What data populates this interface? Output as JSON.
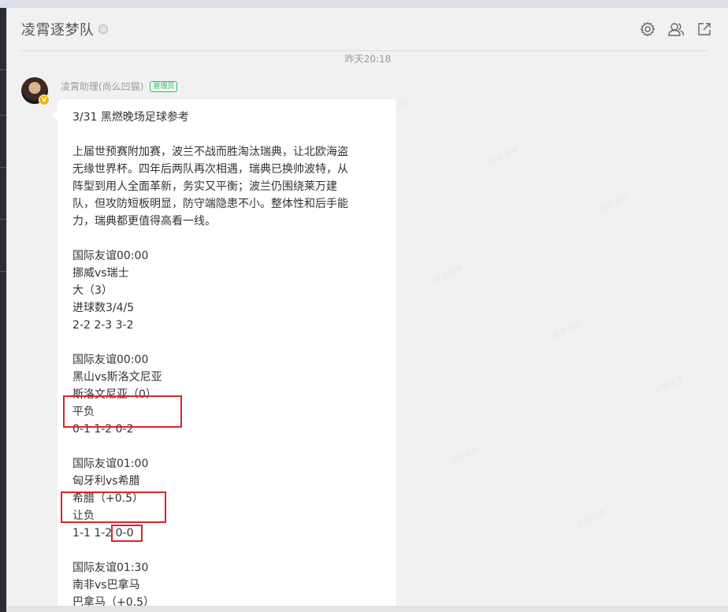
{
  "group": {
    "title": "凌霄逐梦队"
  },
  "header_icons": [
    "gear-icon",
    "members-icon",
    "popout-icon"
  ],
  "timestamp": "昨天20:18",
  "sender": {
    "name": "凌霄助理(尚么凹猫)",
    "badge": "管理员"
  },
  "message": {
    "title": "3/31 黑燃晚场足球参考",
    "intro": [
      "上届世预赛附加赛，波兰不战而胜淘汰瑞典，让北欧海盗",
      "无缘世界杯。四年后两队再次相遇，瑞典已换帅波特，从",
      "阵型到用人全面革新，务实又平衡；波兰仍围绕莱万建",
      "队，但攻防短板明显，防守端隐患不小。整体性和后手能",
      "力，瑞典都更值得高看一线。"
    ],
    "matches": [
      {
        "time": "国际友谊00:00",
        "teams": "挪威vs瑞士",
        "pick": "大（3）",
        "result": "进球数3/4/5",
        "scores": "2-2 2-3 3-2"
      },
      {
        "time": "国际友谊00:00",
        "teams": "黑山vs斯洛文尼亚",
        "pick": "斯洛文尼亚（0）",
        "result": "平负",
        "scores": "0-1 1-2 0-2"
      },
      {
        "time": "国际友谊01:00",
        "teams": "匈牙利vs希腊",
        "pick": "希腊（+0.5）",
        "result": "让负",
        "scores_prefix": "1-1 1-2 ",
        "scores_highlight": "0-0"
      },
      {
        "time": "国际友谊01:30",
        "teams": "南非vs巴拿马",
        "pick": "巴拿马（+0.5）"
      }
    ]
  },
  "colors": {
    "highlight_box": "#e0212b",
    "admin_badge": "#2fbd6b",
    "vip_badge": "#f5b400"
  }
}
